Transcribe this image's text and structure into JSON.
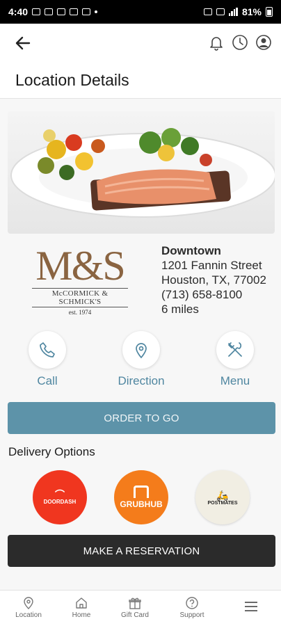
{
  "status_bar": {
    "time": "4:40",
    "battery": "81%"
  },
  "page": {
    "title": "Location Details"
  },
  "logo": {
    "monogram": "M&S",
    "name": "McCORMICK & SCHMICK'S",
    "est": "est. 1974"
  },
  "location": {
    "name": "Downtown",
    "street": "1201 Fannin Street",
    "city": "Houston, TX, 77002",
    "phone": "(713) 658-8100",
    "distance": "6 miles"
  },
  "actions": {
    "call": "Call",
    "direction": "Direction",
    "menu": "Menu"
  },
  "order_button": "ORDER TO GO",
  "delivery": {
    "title": "Delivery Options",
    "doordash": "DOORDASH",
    "grubhub": "GRUBHUB",
    "postmates": "POSTMATES"
  },
  "reservation_button": "MAKE A RESERVATION",
  "nav": {
    "location": "Location",
    "home": "Home",
    "gift_card": "Gift Card",
    "support": "Support"
  },
  "colors": {
    "accent": "#5d93a9",
    "accent_text": "#4f86a0",
    "dark_button": "#2b2b2b",
    "doordash": "#f0361f",
    "grubhub": "#f47c1b",
    "postmates": "#f1eee3",
    "brand_brown": "#8a6441"
  }
}
